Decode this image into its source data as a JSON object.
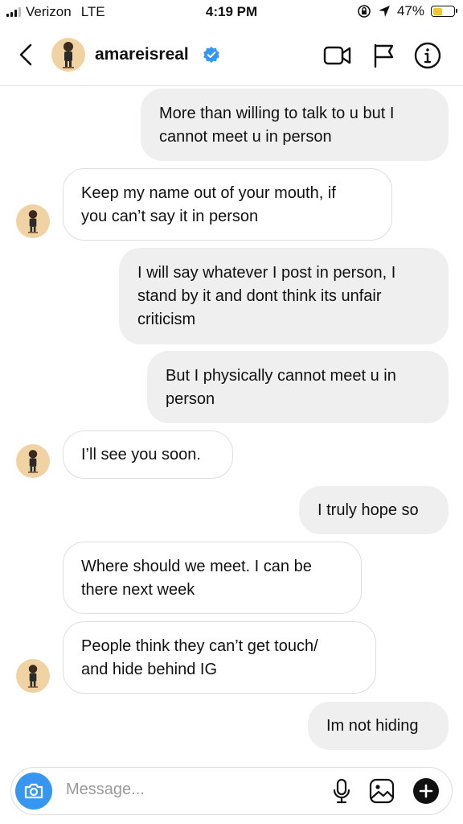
{
  "status_bar": {
    "carrier": "Verizon",
    "network": "LTE",
    "time": "4:19 PM",
    "battery": "47%",
    "battery_level": 0.47
  },
  "header": {
    "username": "amareisreal",
    "verified": true
  },
  "messages": [
    {
      "sender": "me",
      "text": "More than willing to talk to u but I\ncannot meet u in person"
    },
    {
      "sender": "them",
      "text": "Keep my name out of your mouth, if\nyou can’t say it in person"
    },
    {
      "sender": "me",
      "text": "I will say whatever I post in person, I\nstand by it and dont think its unfair\ncriticism"
    },
    {
      "sender": "me",
      "text": "But I physically cannot meet u in\nperson"
    },
    {
      "sender": "them",
      "text": "I’ll see you soon."
    },
    {
      "sender": "me",
      "text": "I truly hope so"
    },
    {
      "sender": "them",
      "text": "Where should we meet. I can be\nthere next week"
    },
    {
      "sender": "them",
      "text": "People think they can’t get touch/\nand hide behind IG"
    },
    {
      "sender": "me",
      "text": "Im not hiding"
    }
  ],
  "composer": {
    "placeholder": "Message..."
  },
  "colors": {
    "accent": "#3797f0",
    "battery": "#f4c430",
    "my_bubble": "#efefef",
    "their_border": "#dedede"
  },
  "icons": [
    "back-chevron-icon",
    "verified-badge-icon",
    "video-call-icon",
    "flag-icon",
    "info-icon",
    "camera-icon",
    "microphone-icon",
    "gallery-icon",
    "plus-icon"
  ]
}
